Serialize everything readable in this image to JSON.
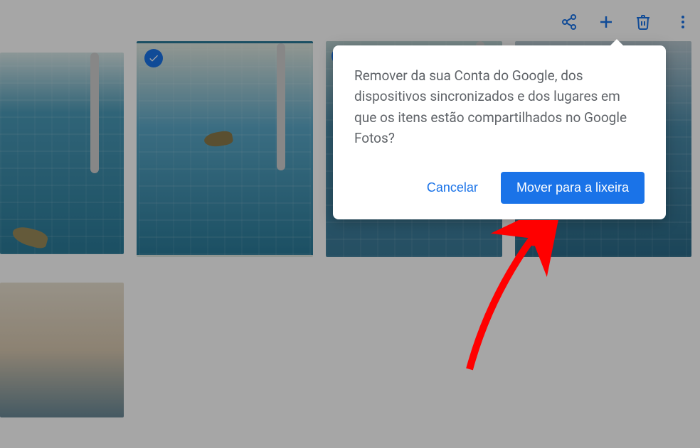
{
  "toolbar": {
    "share_icon": "share-icon",
    "add_icon": "plus-icon",
    "trash_icon": "trash-icon",
    "more_icon": "more-vert-icon"
  },
  "dialog": {
    "message": "Remover da sua Conta do Google, dos dispositivos sincronizados e dos lugares em que os itens estão compartilhados no Google Fotos?",
    "cancel_label": "Cancelar",
    "confirm_label": "Mover para a lixeira"
  },
  "photos": {
    "selected_badge": "checkmark"
  }
}
